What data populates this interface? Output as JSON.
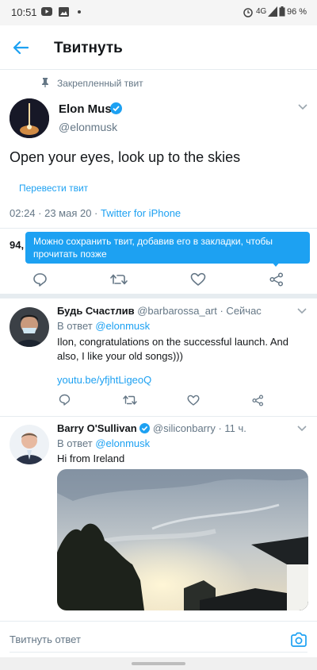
{
  "status_bar": {
    "time": "10:51",
    "network": "4G",
    "battery": "96 %"
  },
  "header": {
    "title": "Твитнуть"
  },
  "pinned": {
    "label": "Закрепленный твит"
  },
  "main_tweet": {
    "author_name": "Elon Musk",
    "handle": "@elonmusk",
    "text": "Open your eyes, look up to the skies",
    "translate_label": "Перевести твит",
    "meta_time": "02:24 · 23 мая 20 · ",
    "meta_source": "Twitter for iPhone",
    "stats_partial": "94,",
    "tooltip": "Можно сохранить твит, добавив его в закладки, чтобы прочитать позже"
  },
  "replies": [
    {
      "author_name": "Будь Счастлив",
      "handle": "@barbarossa_art",
      "time": " · Сейчас",
      "reply_to_prefix": "В ответ ",
      "reply_to_handle": "@elonmusk",
      "text": "Ilon, congratulations on the successful launch.  And also, I like your old songs)))",
      "link": "youtu.be/yfjhtLigeoQ"
    },
    {
      "author_name": "Barry O'Sullivan",
      "handle": "@siliconbarry",
      "time": " · 11 ч.",
      "reply_to_prefix": "В ответ ",
      "reply_to_handle": "@elonmusk",
      "text": "Hi from Ireland"
    }
  ],
  "compose": {
    "placeholder": "Твитнуть ответ"
  },
  "colors": {
    "accent": "#1da1f2",
    "muted": "#657786",
    "verified": "#1da1f2"
  }
}
